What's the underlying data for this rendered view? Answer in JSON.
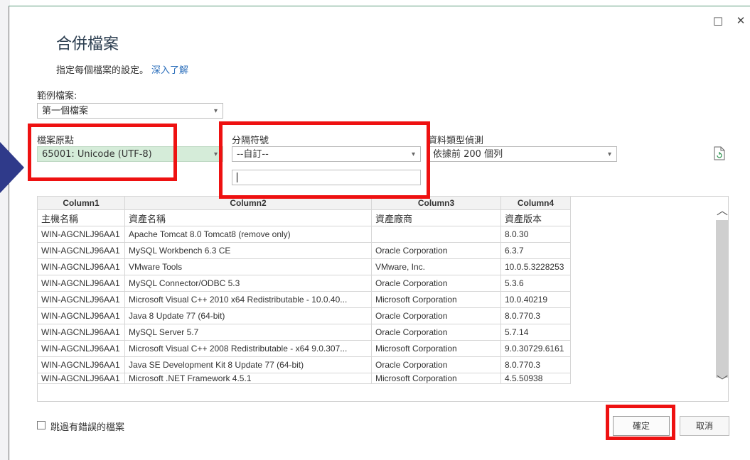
{
  "window": {
    "maximize_icon": "□",
    "close_icon": "✕"
  },
  "dialog": {
    "title": "合併檔案",
    "subtitle": "指定每個檔案的設定。",
    "learn_more": "深入了解"
  },
  "sample_file": {
    "label": "範例檔案:",
    "value": "第一個檔案"
  },
  "file_origin": {
    "label": "檔案原點",
    "value": "65001: Unicode (UTF-8)"
  },
  "delimiter": {
    "label": "分隔符號",
    "value": "--自訂--",
    "custom_value": ""
  },
  "type_detection": {
    "label": "資料類型偵測",
    "value": "依據前 200 個列"
  },
  "table": {
    "columns": [
      "Column1",
      "Column2",
      "Column3",
      "Column4"
    ],
    "header_row": [
      "主機名稱",
      "資產名稱",
      "資產廠商",
      "資產版本"
    ],
    "rows": [
      [
        "WIN-AGCNLJ96AA1",
        "Apache Tomcat 8.0 Tomcat8 (remove only)",
        "",
        "8.0.30"
      ],
      [
        "WIN-AGCNLJ96AA1",
        "MySQL Workbench 6.3 CE",
        "Oracle Corporation",
        "6.3.7"
      ],
      [
        "WIN-AGCNLJ96AA1",
        "VMware Tools",
        "VMware, Inc.",
        "10.0.5.3228253"
      ],
      [
        "WIN-AGCNLJ96AA1",
        "MySQL Connector/ODBC 5.3",
        "Oracle Corporation",
        "5.3.6"
      ],
      [
        "WIN-AGCNLJ96AA1",
        "Microsoft Visual C++ 2010  x64 Redistributable - 10.0.40...",
        "Microsoft Corporation",
        "10.0.40219"
      ],
      [
        "WIN-AGCNLJ96AA1",
        "Java 8 Update 77 (64-bit)",
        "Oracle Corporation",
        "8.0.770.3"
      ],
      [
        "WIN-AGCNLJ96AA1",
        "MySQL Server 5.7",
        "Oracle Corporation",
        "5.7.14"
      ],
      [
        "WIN-AGCNLJ96AA1",
        "Microsoft Visual C++ 2008 Redistributable - x64 9.0.307...",
        "Microsoft Corporation",
        "9.0.30729.6161"
      ],
      [
        "WIN-AGCNLJ96AA1",
        "Java SE Development Kit 8 Update 77 (64-bit)",
        "Oracle Corporation",
        "8.0.770.3"
      ],
      [
        "WIN-AGCNLJ96AA1",
        "Microsoft .NET Framework 4.5.1",
        "Microsoft Corporation",
        "4.5.50938"
      ]
    ]
  },
  "skip_errors": {
    "label": "跳過有錯誤的檔案"
  },
  "buttons": {
    "ok": "確定",
    "cancel": "取消"
  },
  "colors": {
    "highlight": "#ee1111",
    "accent_link": "#2a6ebb",
    "origin_bg": "#d5ecd9"
  }
}
